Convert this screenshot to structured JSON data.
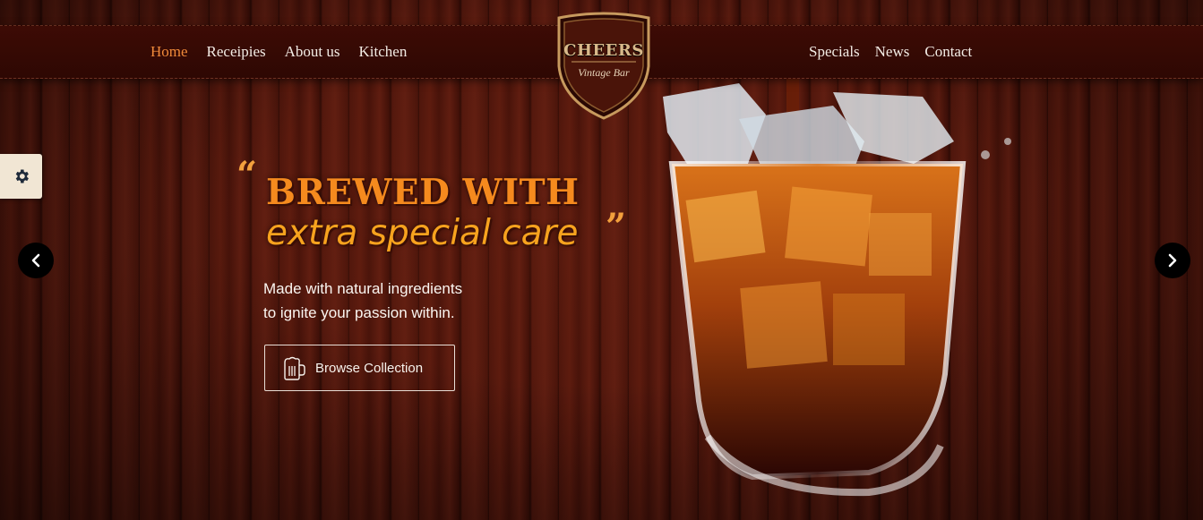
{
  "nav": {
    "left": [
      {
        "label": "Home",
        "active": true
      },
      {
        "label": "Receipies",
        "active": false
      },
      {
        "label": "About us",
        "active": false
      },
      {
        "label": "Kitchen",
        "active": false
      }
    ],
    "right": [
      {
        "label": "Specials"
      },
      {
        "label": "News"
      },
      {
        "label": "Contact"
      }
    ]
  },
  "logo": {
    "title": "CHEERS",
    "subtitle": "Vintage Bar"
  },
  "hero": {
    "quote_open": "“",
    "quote_close": "”",
    "headline_line1": "BREWED WITH",
    "headline_line2": "extra special care",
    "subtext_line1": "Made with natural ingredients",
    "subtext_line2": "to ignite your passion within.",
    "cta_label": "Browse Collection"
  },
  "icons": {
    "settings": "gear-icon",
    "prev": "chevron-left-icon",
    "next": "chevron-right-icon",
    "cta": "beer-mug-icon"
  },
  "colors": {
    "accent": "#f08a3a",
    "headline": "#f58a1e",
    "navbar": "#3d0b05"
  }
}
